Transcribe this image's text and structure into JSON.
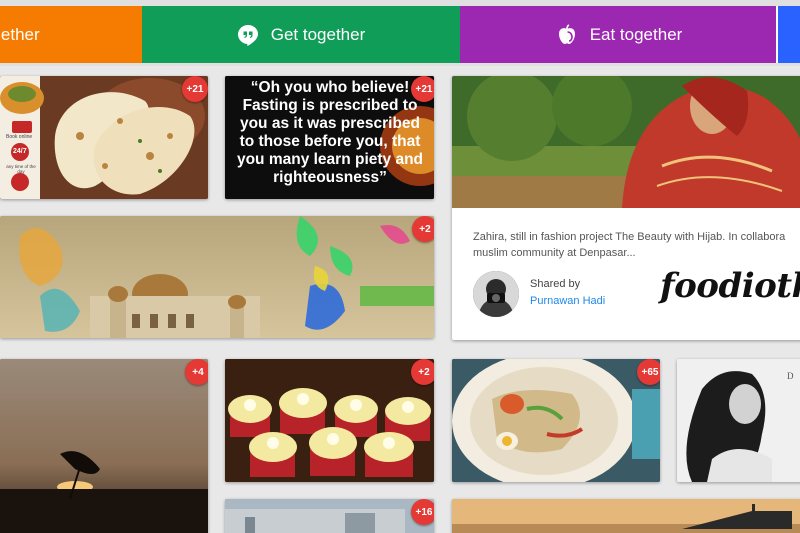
{
  "tabs": [
    {
      "label": "ogether",
      "color": "#f57c00"
    },
    {
      "label": "Get together",
      "icon": "hangouts-quote-icon",
      "color": "#0f9d58"
    },
    {
      "label": "Eat together",
      "icon": "apple-icon",
      "color": "#9c27b0"
    }
  ],
  "cards": {
    "naan": {
      "badge": "+21",
      "side_labels": [
        "Book online",
        "any time of the day"
      ],
      "hours": "24/7"
    },
    "quote": {
      "badge": "+21",
      "text": "“Oh you who believe! Fasting is prescribed to you as it was prescribed to those before you, that you many learn piety and righteousness”"
    },
    "mosque": {
      "badge": "+2"
    },
    "featured": {
      "caption_line1": "Zahira, still in fashion project The Beauty with Hijab. In collabora",
      "caption_line2": "muslim community at Denpasar...",
      "shared_label": "Shared by",
      "shared_name": "Purnawan Hadi",
      "brand": "foodiotkk"
    },
    "sunset": {
      "badge": "+4"
    },
    "cakes": {
      "badge": "+2"
    },
    "plate": {
      "badge": "+65"
    },
    "bottom1": {
      "badge": "+16"
    }
  },
  "colors": {
    "badge": "#e53935",
    "link": "#1e88e5"
  }
}
